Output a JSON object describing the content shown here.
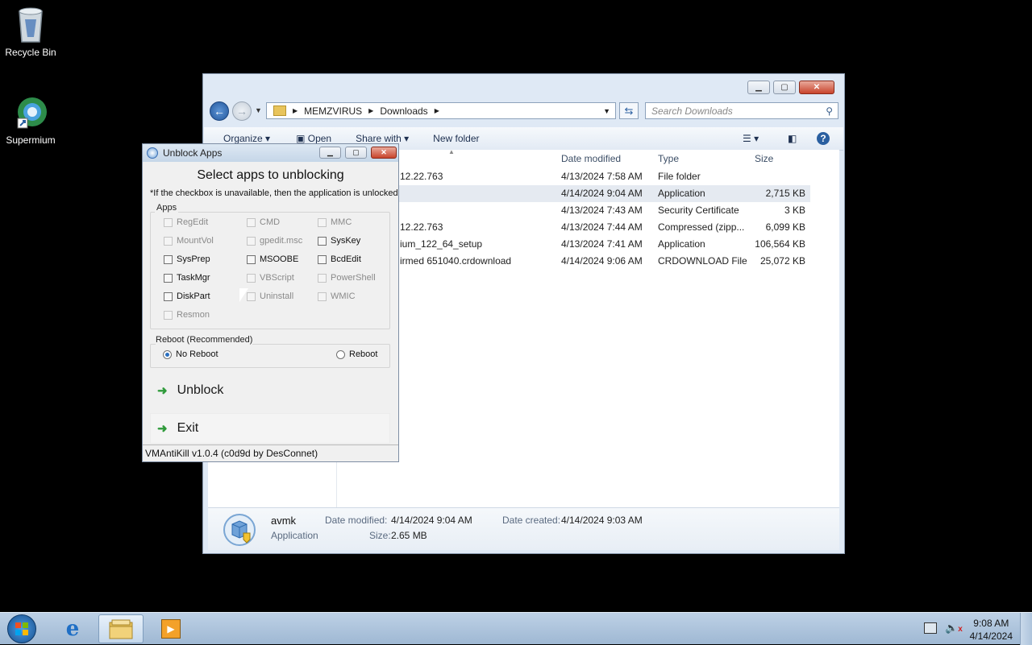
{
  "desktop": {
    "icons": [
      {
        "label": "Recycle Bin",
        "icon": "recycle-bin-icon"
      },
      {
        "label": "Supermium",
        "icon": "supermium-icon"
      }
    ]
  },
  "explorer": {
    "address": {
      "root": "MEMZVIRUS",
      "folder": "Downloads"
    },
    "search_placeholder": "Search Downloads",
    "toolbar": {
      "organize": "Organize",
      "open": "Open",
      "share_with": "Share with",
      "new_folder": "New folder"
    },
    "columns": {
      "date_modified": "Date modified",
      "type": "Type",
      "size": "Size"
    },
    "rows": [
      {
        "name": "12.22.763",
        "date": "4/13/2024 7:58 AM",
        "type": "File folder",
        "size": ""
      },
      {
        "name": "",
        "date": "4/14/2024 9:04 AM",
        "type": "Application",
        "size": "2,715 KB"
      },
      {
        "name": "",
        "date": "4/13/2024 7:43 AM",
        "type": "Security Certificate",
        "size": "3 KB"
      },
      {
        "name": "12.22.763",
        "date": "4/13/2024 7:44 AM",
        "type": "Compressed (zipp...",
        "size": "6,099 KB"
      },
      {
        "name": "ium_122_64_setup",
        "date": "4/13/2024 7:41 AM",
        "type": "Application",
        "size": "106,564 KB"
      },
      {
        "name": "irmed 651040.crdownload",
        "date": "4/14/2024 9:06 AM",
        "type": "CRDOWNLOAD File",
        "size": "25,072 KB"
      }
    ],
    "details": {
      "name": "avmk",
      "type": "Application",
      "date_modified_label": "Date modified:",
      "date_modified": "4/14/2024 9:04 AM",
      "date_created_label": "Date created:",
      "date_created": "4/14/2024 9:03 AM",
      "size_label": "Size:",
      "size": "2.65 MB"
    }
  },
  "dialog": {
    "title": "Unblock Apps",
    "heading": "Select apps to unblocking",
    "note": "*If the checkbox is unavailable, then the application is unlocked",
    "apps_label": "Apps",
    "apps": [
      {
        "label": "RegEdit",
        "enabled": false
      },
      {
        "label": "CMD",
        "enabled": false
      },
      {
        "label": "MMC",
        "enabled": false
      },
      {
        "label": "MountVol",
        "enabled": false
      },
      {
        "label": "gpedit.msc",
        "enabled": false
      },
      {
        "label": "SysKey",
        "enabled": true
      },
      {
        "label": "SysPrep",
        "enabled": true
      },
      {
        "label": "MSOOBE",
        "enabled": true
      },
      {
        "label": "BcdEdit",
        "enabled": true
      },
      {
        "label": "TaskMgr",
        "enabled": true
      },
      {
        "label": "VBScript",
        "enabled": false
      },
      {
        "label": "PowerShell",
        "enabled": false
      },
      {
        "label": "DiskPart",
        "enabled": true
      },
      {
        "label": "Uninstall",
        "enabled": false
      },
      {
        "label": "WMIC",
        "enabled": false
      },
      {
        "label": "Resmon",
        "enabled": false
      }
    ],
    "reboot_label": "Reboot (Recommended)",
    "no_reboot": "No Reboot",
    "reboot": "Reboot",
    "unblock_button": "Unblock",
    "exit_button": "Exit",
    "status": "VMAntiKill v1.0.4 (c0d9d by DesConnet)"
  },
  "taskbar": {
    "time": "9:08 AM",
    "date": "4/14/2024"
  }
}
